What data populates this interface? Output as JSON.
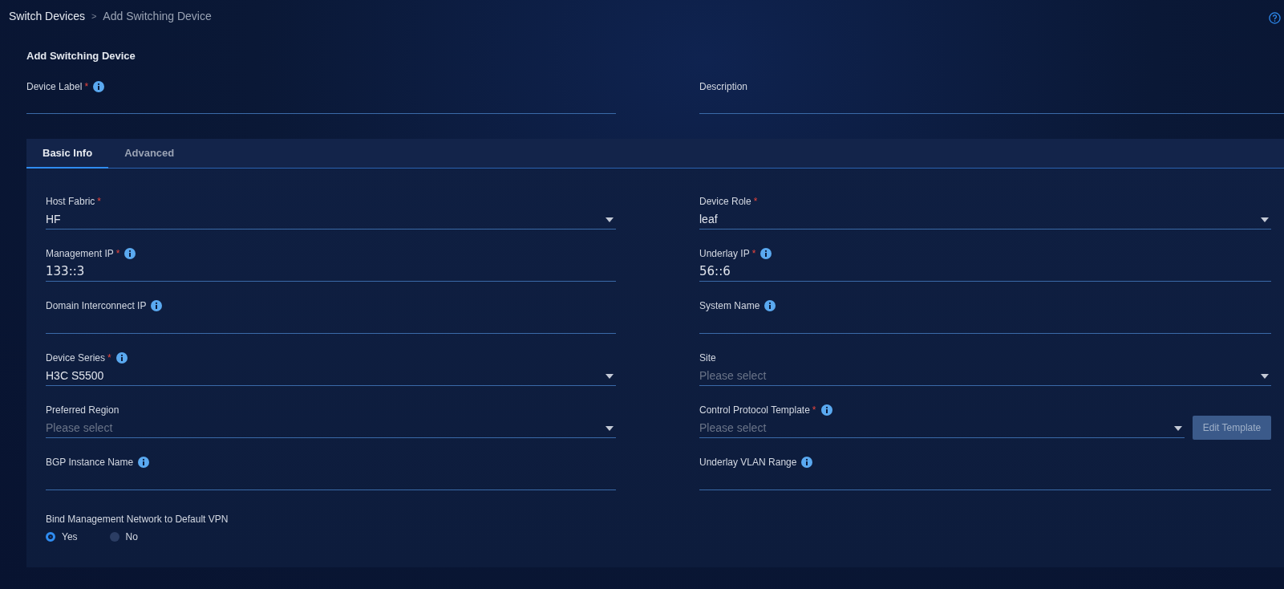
{
  "breadcrumb": {
    "separator": ">",
    "items": [
      {
        "label": "Switch Devices",
        "current": false
      },
      {
        "label": "Add Switching Device",
        "current": true
      }
    ]
  },
  "form": {
    "title": "Add Switching Device",
    "top_fields": [
      {
        "label": "Device Label",
        "required_mark": "*",
        "info": true
      },
      {
        "label": "Description",
        "info": false
      }
    ],
    "tabs": [
      {
        "label": "Basic Info",
        "selected": true
      },
      {
        "label": "Advanced",
        "selected": false
      }
    ],
    "fields": [
      {
        "label": "Host Fabric",
        "required_mark": "*",
        "info": false,
        "kind": "select",
        "value": "HF"
      },
      {
        "label": "Device Role",
        "required_mark": "*",
        "info": false,
        "kind": "select",
        "value": "leaf"
      },
      {
        "label": "Management IP",
        "required_mark": "*",
        "info": true,
        "kind": "input",
        "value": "133::3"
      },
      {
        "label": "Underlay IP",
        "required_mark": "*",
        "info": true,
        "kind": "input",
        "value": "56::6"
      },
      {
        "label": "Domain Interconnect IP",
        "info": true,
        "kind": "input"
      },
      {
        "label": "System Name",
        "info": true,
        "kind": "input"
      },
      {
        "label": "Device Series",
        "required_mark": "*",
        "info": true,
        "kind": "select",
        "value": "H3C S5500"
      },
      {
        "label": "Site",
        "info": false,
        "kind": "select",
        "placeholder": "Please select"
      },
      {
        "label": "Preferred Region",
        "info": false,
        "kind": "select",
        "placeholder": "Please select"
      },
      {
        "label": "Control Protocol Template",
        "required_mark": "*",
        "info": true,
        "kind": "select",
        "placeholder": "Please select",
        "button": {
          "label": "Edit Template",
          "disabled": true
        }
      },
      {
        "label": "BGP Instance Name",
        "info": true,
        "kind": "input"
      },
      {
        "label": "Underlay VLAN Range",
        "info": true,
        "kind": "input"
      }
    ],
    "radio_group": {
      "label": "Bind Management Network to Default VPN",
      "options": [
        {
          "label": "Yes",
          "selected": true
        },
        {
          "label": "No",
          "selected": false
        }
      ]
    }
  }
}
